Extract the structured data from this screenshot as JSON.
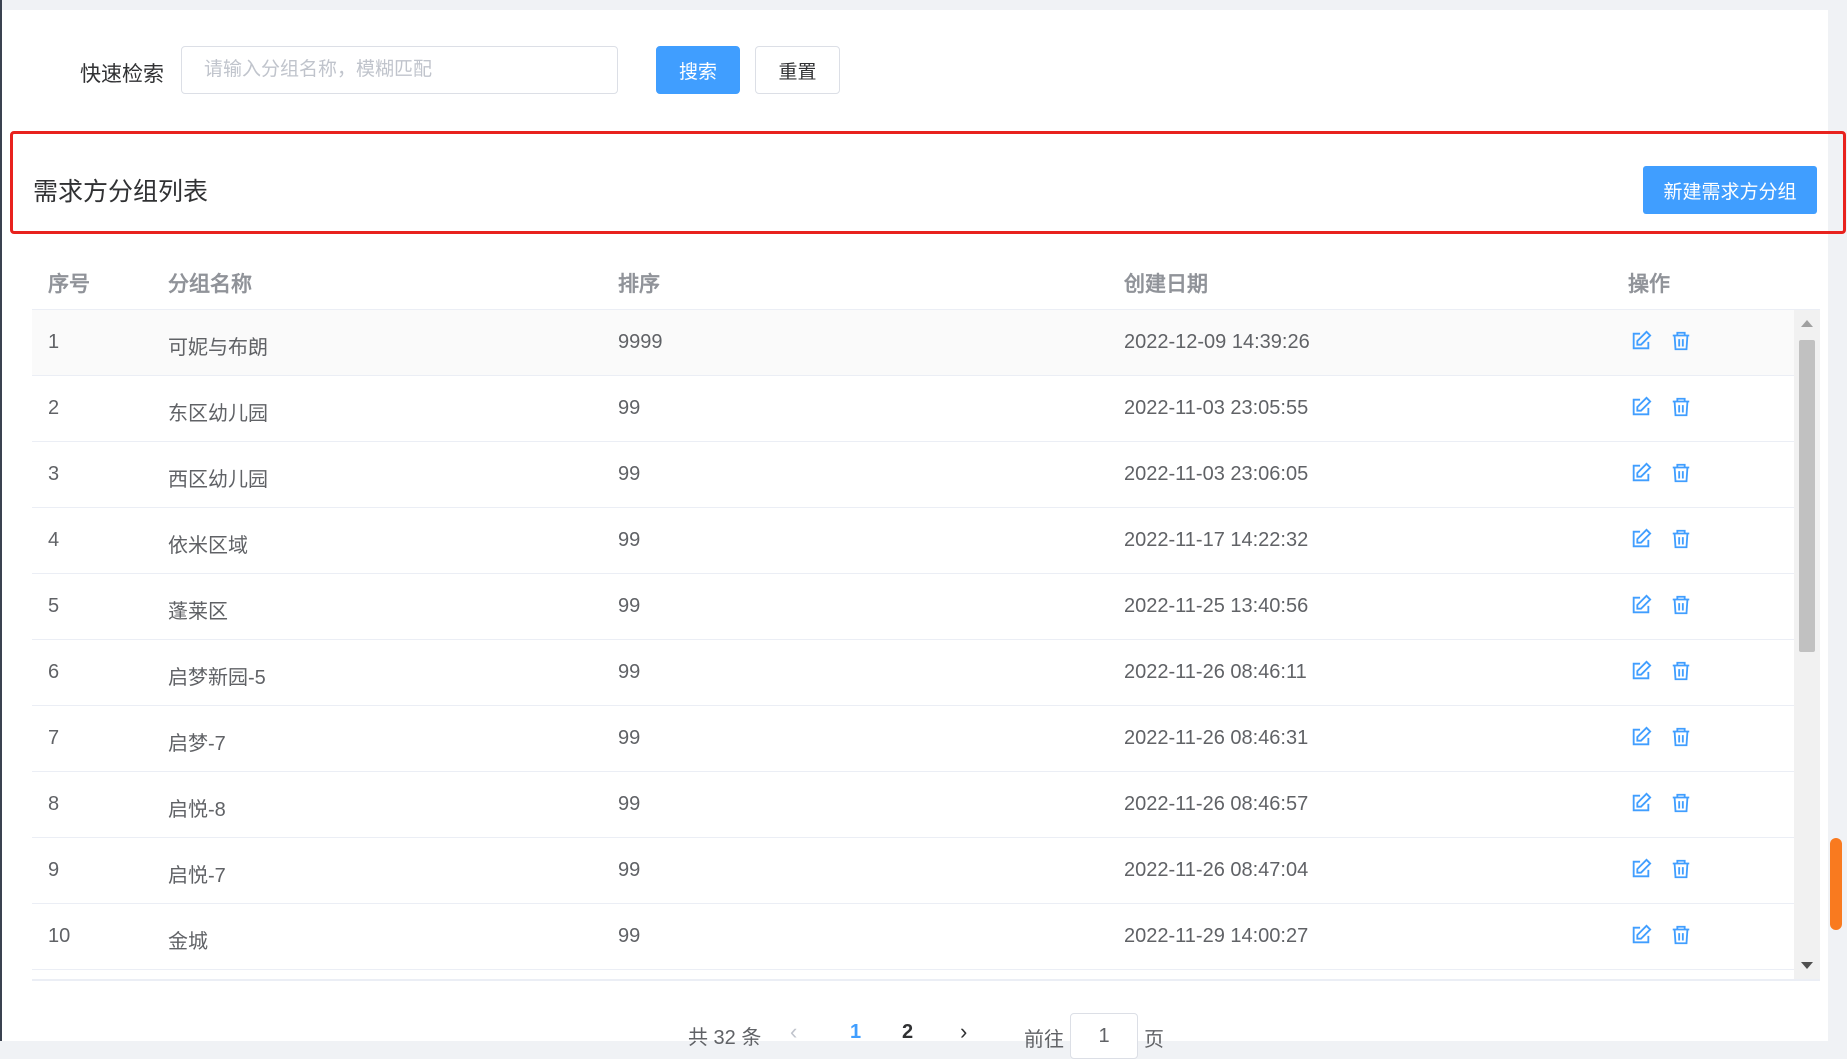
{
  "search": {
    "label": "快速检索",
    "placeholder": "请输入分组名称，模糊匹配",
    "value": "",
    "search_button": "搜索",
    "reset_button": "重置"
  },
  "list": {
    "title": "需求方分组列表",
    "new_button": "新建需求方分组"
  },
  "table": {
    "headers": [
      "序号",
      "分组名称",
      "排序",
      "创建日期",
      "操作"
    ],
    "rows": [
      {
        "index": "1",
        "name": "可妮与布朗",
        "sort": "9999",
        "created": "2022-12-09 14:39:26"
      },
      {
        "index": "2",
        "name": "东区幼儿园",
        "sort": "99",
        "created": "2022-11-03 23:05:55"
      },
      {
        "index": "3",
        "name": "西区幼儿园",
        "sort": "99",
        "created": "2022-11-03 23:06:05"
      },
      {
        "index": "4",
        "name": "依米区域",
        "sort": "99",
        "created": "2022-11-17 14:22:32"
      },
      {
        "index": "5",
        "name": "蓬莱区",
        "sort": "99",
        "created": "2022-11-25 13:40:56"
      },
      {
        "index": "6",
        "name": "启梦新园-5",
        "sort": "99",
        "created": "2022-11-26 08:46:11"
      },
      {
        "index": "7",
        "name": "启梦-7",
        "sort": "99",
        "created": "2022-11-26 08:46:31"
      },
      {
        "index": "8",
        "name": "启悦-8",
        "sort": "99",
        "created": "2022-11-26 08:46:57"
      },
      {
        "index": "9",
        "name": "启悦-7",
        "sort": "99",
        "created": "2022-11-26 08:47:04"
      },
      {
        "index": "10",
        "name": "金城",
        "sort": "99",
        "created": "2022-11-29 14:00:27"
      }
    ],
    "row_actions": [
      "edit-icon",
      "delete-icon"
    ]
  },
  "pagination": {
    "total_text": "共 32 条",
    "pages": [
      "1",
      "2"
    ],
    "current_page": "1",
    "goto_label": "前往",
    "goto_value": "1",
    "goto_suffix": "页"
  },
  "colors": {
    "primary": "#409eff",
    "highlight_border": "#e8221e",
    "header_text": "#909399",
    "body_text": "#606266"
  }
}
